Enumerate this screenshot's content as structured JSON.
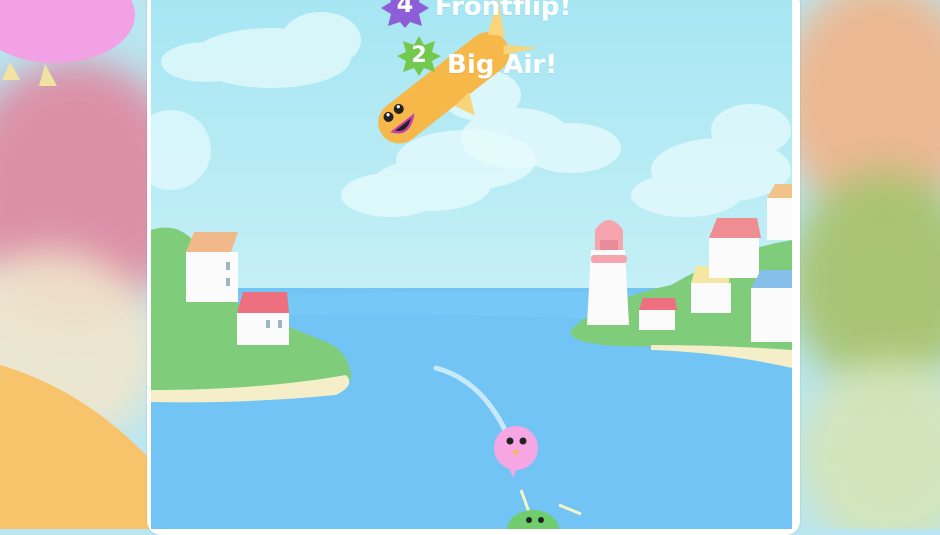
{
  "hud": {
    "trick_1": {
      "count": "4",
      "label": "Frontflip!"
    },
    "trick_2": {
      "count": "2",
      "label": "Big Air!"
    }
  },
  "colors": {
    "sky": "#a6e6f3",
    "sea": "#72c4f4",
    "land": "#7fcc7a",
    "sand": "#f6efc8",
    "player": "#f7b84a",
    "pink_bird": "#f5a6e3",
    "badge_purple": "#8e5ed6",
    "badge_green": "#73c94f"
  },
  "icons": [
    "starburst-badge-icon",
    "player-character-icon",
    "pink-bird-icon",
    "green-bird-icon",
    "lighthouse-icon",
    "house-icon",
    "cloud-icon"
  ]
}
